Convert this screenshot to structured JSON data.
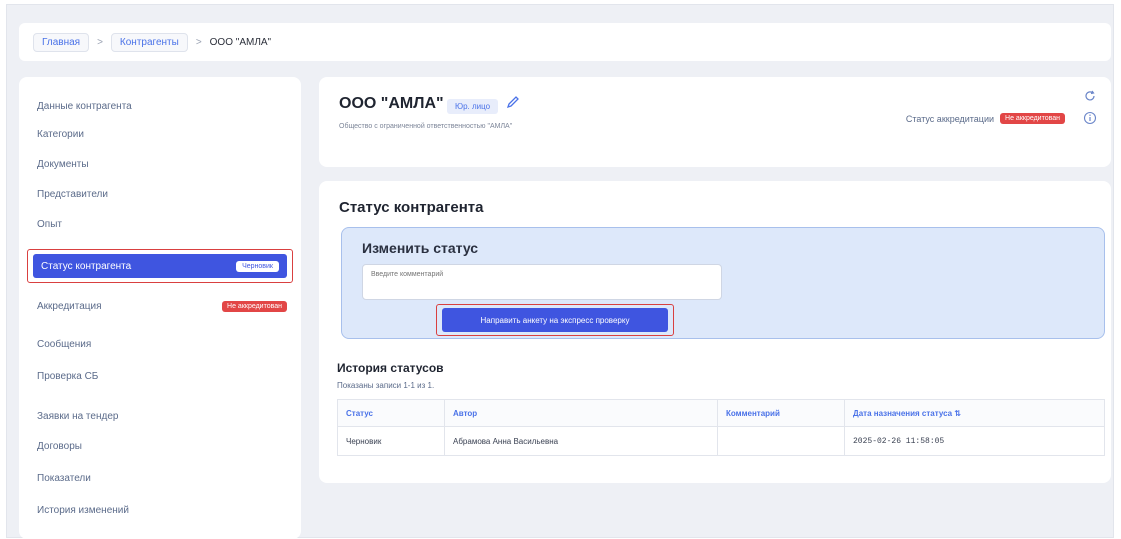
{
  "breadcrumb": {
    "items": [
      "Главная",
      "Контрагенты"
    ],
    "current": "ООО \"АМЛА\""
  },
  "sidebar": {
    "items": [
      {
        "label": "Данные контрагента"
      },
      {
        "label": "Категории"
      },
      {
        "label": "Документы"
      },
      {
        "label": "Представители"
      },
      {
        "label": "Опыт"
      },
      {
        "label": "Статус контрагента",
        "badge": "Черновик",
        "active": true
      },
      {
        "label": "Аккредитация",
        "badge": "Не аккредитован"
      },
      {
        "label": "Сообщения"
      },
      {
        "label": "Проверка СБ"
      },
      {
        "label": "Заявки на тендер"
      },
      {
        "label": "Договоры"
      },
      {
        "label": "Показатели"
      },
      {
        "label": "История изменений"
      }
    ]
  },
  "header": {
    "org_name": "ООО \"АМЛА\"",
    "type_badge": "Юр. лицо",
    "org_full_name": "Общество с ограниченной ответственностью \"АМЛА\"",
    "accreditation_label": "Статус аккредитации",
    "accreditation_badge": "Не аккредитован"
  },
  "status_section": {
    "title": "Статус контрагента",
    "change": {
      "title": "Изменить статус",
      "comment_placeholder": "Введите комментарий",
      "submit_label": "Направить анкету на экспресс проверку"
    },
    "history": {
      "title": "История статусов",
      "count_text": "Показаны записи 1-1 из 1.",
      "columns": [
        "Статус",
        "Автор",
        "Комментарий",
        "Дата назначения статуса ⇅"
      ],
      "rows": [
        [
          "Черновик",
          "Абрамова Анна Васильевна",
          "",
          "2025-02-26 11:58:05"
        ]
      ]
    }
  },
  "colors": {
    "accent": "#3f55e0",
    "danger": "#e24646",
    "highlight_outline": "#d94040"
  }
}
